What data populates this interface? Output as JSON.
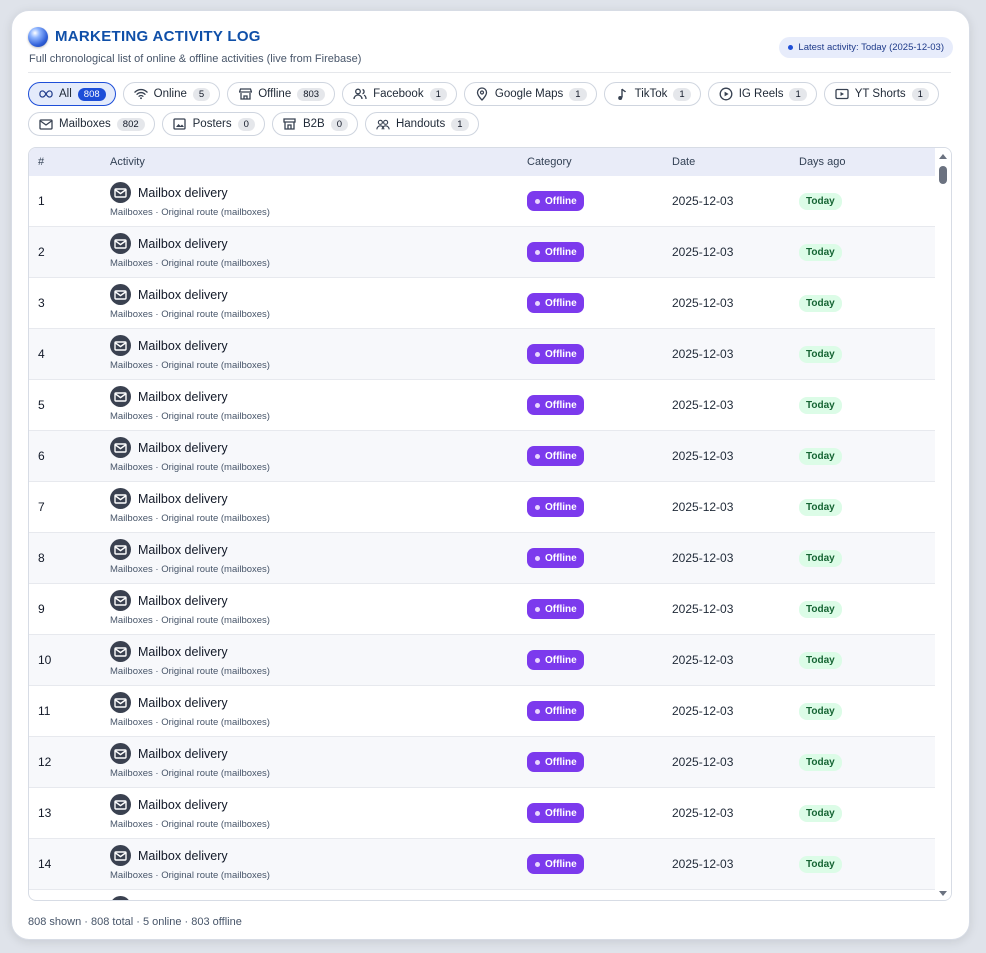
{
  "header": {
    "title": "MARKETING ACTIVITY LOG",
    "subtitle": "Full chronological list of online & offline activities (live from Firebase)",
    "latest": "Latest activity: Today (2025-12-03)"
  },
  "filters": {
    "row1": [
      {
        "label": "All",
        "count": "808",
        "icon": "infinity-icon",
        "active": true
      },
      {
        "label": "Online",
        "count": "5",
        "icon": "wifi-icon"
      },
      {
        "label": "Offline",
        "count": "803",
        "icon": "store-icon"
      },
      {
        "label": "Facebook",
        "count": "1",
        "icon": "users-icon"
      },
      {
        "label": "Google Maps",
        "count": "1",
        "icon": "map-pin-icon"
      },
      {
        "label": "TikTok",
        "count": "1",
        "icon": "music-note-icon"
      },
      {
        "label": "IG Reels",
        "count": "1",
        "icon": "play-circle-icon"
      },
      {
        "label": "YT Shorts",
        "count": "1",
        "icon": "video-icon"
      }
    ],
    "row2": [
      {
        "label": "Mailboxes",
        "count": "802",
        "icon": "mail-icon"
      },
      {
        "label": "Posters",
        "count": "0",
        "icon": "image-icon"
      },
      {
        "label": "B2B",
        "count": "0",
        "icon": "building-icon"
      },
      {
        "label": "Handouts",
        "count": "1",
        "icon": "people-icon"
      }
    ]
  },
  "table": {
    "headers": {
      "num": "#",
      "activity": "Activity",
      "category": "Category",
      "date": "Date",
      "days_ago": "Days ago"
    },
    "rows": [
      {
        "num": "1",
        "title": "Mailbox delivery",
        "sub": "Mailboxes · Original route (mailboxes)",
        "category": "Offline",
        "date": "2025-12-03",
        "ago": "Today"
      },
      {
        "num": "2",
        "title": "Mailbox delivery",
        "sub": "Mailboxes · Original route (mailboxes)",
        "category": "Offline",
        "date": "2025-12-03",
        "ago": "Today"
      },
      {
        "num": "3",
        "title": "Mailbox delivery",
        "sub": "Mailboxes · Original route (mailboxes)",
        "category": "Offline",
        "date": "2025-12-03",
        "ago": "Today"
      },
      {
        "num": "4",
        "title": "Mailbox delivery",
        "sub": "Mailboxes · Original route (mailboxes)",
        "category": "Offline",
        "date": "2025-12-03",
        "ago": "Today"
      },
      {
        "num": "5",
        "title": "Mailbox delivery",
        "sub": "Mailboxes · Original route (mailboxes)",
        "category": "Offline",
        "date": "2025-12-03",
        "ago": "Today"
      },
      {
        "num": "6",
        "title": "Mailbox delivery",
        "sub": "Mailboxes · Original route (mailboxes)",
        "category": "Offline",
        "date": "2025-12-03",
        "ago": "Today"
      },
      {
        "num": "7",
        "title": "Mailbox delivery",
        "sub": "Mailboxes · Original route (mailboxes)",
        "category": "Offline",
        "date": "2025-12-03",
        "ago": "Today"
      },
      {
        "num": "8",
        "title": "Mailbox delivery",
        "sub": "Mailboxes · Original route (mailboxes)",
        "category": "Offline",
        "date": "2025-12-03",
        "ago": "Today"
      },
      {
        "num": "9",
        "title": "Mailbox delivery",
        "sub": "Mailboxes · Original route (mailboxes)",
        "category": "Offline",
        "date": "2025-12-03",
        "ago": "Today"
      },
      {
        "num": "10",
        "title": "Mailbox delivery",
        "sub": "Mailboxes · Original route (mailboxes)",
        "category": "Offline",
        "date": "2025-12-03",
        "ago": "Today"
      },
      {
        "num": "11",
        "title": "Mailbox delivery",
        "sub": "Mailboxes · Original route (mailboxes)",
        "category": "Offline",
        "date": "2025-12-03",
        "ago": "Today"
      },
      {
        "num": "12",
        "title": "Mailbox delivery",
        "sub": "Mailboxes · Original route (mailboxes)",
        "category": "Offline",
        "date": "2025-12-03",
        "ago": "Today"
      },
      {
        "num": "13",
        "title": "Mailbox delivery",
        "sub": "Mailboxes · Original route (mailboxes)",
        "category": "Offline",
        "date": "2025-12-03",
        "ago": "Today"
      },
      {
        "num": "14",
        "title": "Mailbox delivery",
        "sub": "Mailboxes · Original route (mailboxes)",
        "category": "Offline",
        "date": "2025-12-03",
        "ago": "Today"
      }
    ]
  },
  "footer": {
    "summary": "808 shown · 808 total · 5 online · 803 offline"
  },
  "colors": {
    "accent": "#1d4ed8",
    "offline_badge": "#7c3aed",
    "today_badge_bg": "#dcfce7",
    "title": "#0f4fa8"
  }
}
